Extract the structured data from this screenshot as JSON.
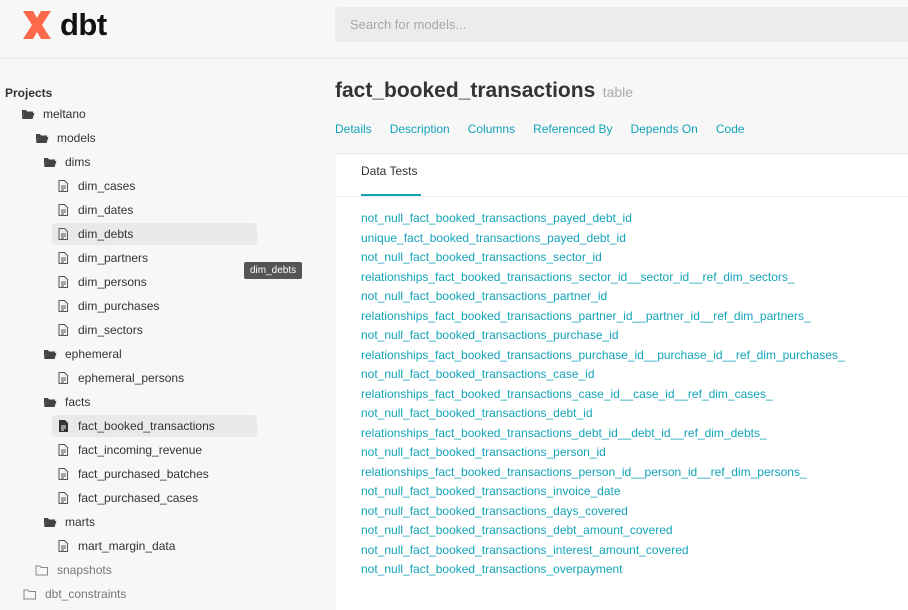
{
  "brand": {
    "name": "dbt",
    "color": "#ff694b"
  },
  "search": {
    "placeholder": "Search for models..."
  },
  "sidebar": {
    "title": "Projects",
    "tooltip": "dim_debts",
    "items": [
      {
        "label": "meltano",
        "icon": "folder-open-icon"
      },
      {
        "label": "models",
        "icon": "folder-open-icon"
      },
      {
        "label": "dims",
        "icon": "folder-open-icon"
      },
      {
        "label": "dim_cases",
        "icon": "file-icon"
      },
      {
        "label": "dim_dates",
        "icon": "file-icon"
      },
      {
        "label": "dim_debts",
        "icon": "file-icon"
      },
      {
        "label": "dim_partners",
        "icon": "file-icon"
      },
      {
        "label": "dim_persons",
        "icon": "file-icon"
      },
      {
        "label": "dim_purchases",
        "icon": "file-icon"
      },
      {
        "label": "dim_sectors",
        "icon": "file-icon"
      },
      {
        "label": "ephemeral",
        "icon": "folder-open-icon"
      },
      {
        "label": "ephemeral_persons",
        "icon": "file-icon"
      },
      {
        "label": "facts",
        "icon": "folder-open-icon"
      },
      {
        "label": "fact_booked_transactions",
        "icon": "file-filled-icon"
      },
      {
        "label": "fact_incoming_revenue",
        "icon": "file-icon"
      },
      {
        "label": "fact_purchased_batches",
        "icon": "file-icon"
      },
      {
        "label": "fact_purchased_cases",
        "icon": "file-icon"
      },
      {
        "label": "marts",
        "icon": "folder-open-icon"
      },
      {
        "label": "mart_margin_data",
        "icon": "file-icon"
      },
      {
        "label": "snapshots",
        "icon": "folder-closed-icon"
      },
      {
        "label": "dbt_constraints",
        "icon": "folder-closed-icon"
      }
    ]
  },
  "model": {
    "name": "fact_booked_transactions",
    "type": "table"
  },
  "nav": {
    "details": "Details",
    "description": "Description",
    "columns": "Columns",
    "referenced_by": "Referenced By",
    "depends_on": "Depends On",
    "code": "Code"
  },
  "panel": {
    "tab": "Data Tests",
    "tests": [
      "not_null_fact_booked_transactions_payed_debt_id",
      "unique_fact_booked_transactions_payed_debt_id",
      "not_null_fact_booked_transactions_sector_id",
      "relationships_fact_booked_transactions_sector_id__sector_id__ref_dim_sectors_",
      "not_null_fact_booked_transactions_partner_id",
      "relationships_fact_booked_transactions_partner_id__partner_id__ref_dim_partners_",
      "not_null_fact_booked_transactions_purchase_id",
      "relationships_fact_booked_transactions_purchase_id__purchase_id__ref_dim_purchases_",
      "not_null_fact_booked_transactions_case_id",
      "relationships_fact_booked_transactions_case_id__case_id__ref_dim_cases_",
      "not_null_fact_booked_transactions_debt_id",
      "relationships_fact_booked_transactions_debt_id__debt_id__ref_dim_debts_",
      "not_null_fact_booked_transactions_person_id",
      "relationships_fact_booked_transactions_person_id__person_id__ref_dim_persons_",
      "not_null_fact_booked_transactions_invoice_date",
      "not_null_fact_booked_transactions_days_covered",
      "not_null_fact_booked_transactions_debt_amount_covered",
      "not_null_fact_booked_transactions_interest_amount_covered",
      "not_null_fact_booked_transactions_overpayment"
    ]
  },
  "colors": {
    "accent": "#13a3b9",
    "brand": "#ff694b",
    "text": "#333333"
  }
}
